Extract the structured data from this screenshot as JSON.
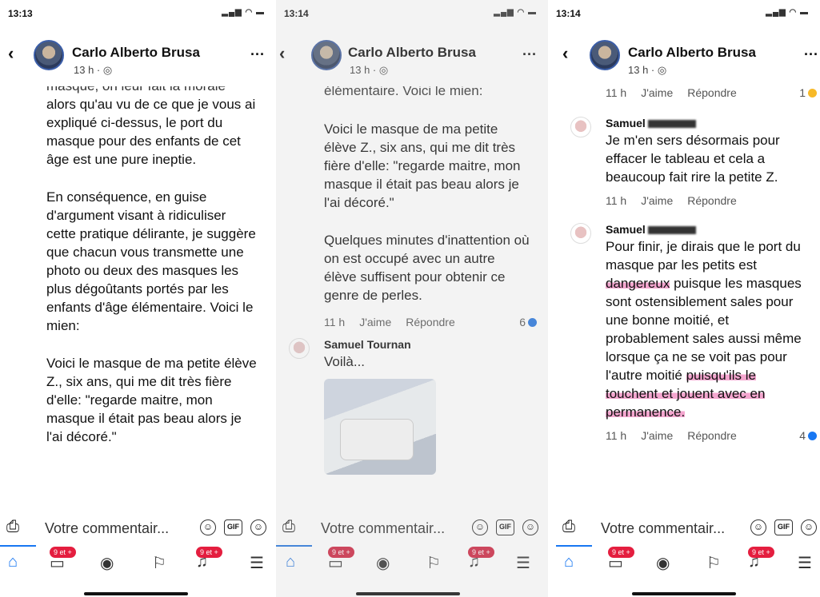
{
  "panels": [
    {
      "status_time": "13:13",
      "author": "Carlo Alberto Brusa",
      "time": "13 h · ",
      "post_partial": "masque, on leur fait la morale",
      "post_paragraphs": [
        "alors qu'au vu de ce que je vous ai expliqué ci-dessus, le port du masque pour des enfants de cet âge est une pure ineptie.",
        "En conséquence, en guise d'argument visant à ridiculiser cette pratique délirante, je suggère que chacun vous transmette une photo ou deux des masques les plus dégoûtants portés par les enfants d'âge élémentaire. Voici le mien:",
        "Voici le masque de ma petite élève Z., six ans, qui me dit très fière d'elle: \"regarde maitre, mon masque il était pas beau alors je l'ai décoré.\""
      ]
    },
    {
      "status_time": "13:14",
      "author": "Carlo Alberto Brusa",
      "time": "13 h · ",
      "post_partial": "élémentaire. Voici le mien:",
      "post_paragraphs": [
        "Voici le masque de ma petite élève Z., six ans, qui me dit très fière d'elle: \"regarde maitre, mon masque il était pas beau alors je l'ai décoré.\"",
        "Quelques minutes d'inattention où on est occupé avec un autre élève suffisent pour obtenir ce genre de perles."
      ],
      "meta": {
        "time": "11 h",
        "like": "J'aime",
        "reply": "Répondre",
        "count": "6"
      },
      "comment": {
        "name": "Samuel Tournan",
        "text": "Voilà..."
      }
    },
    {
      "status_time": "13:14",
      "author": "Carlo Alberto Brusa",
      "time": "13 h · ",
      "top_meta": {
        "time": "11 h",
        "like": "J'aime",
        "reply": "Répondre",
        "count": "1"
      },
      "comment1": {
        "name": "Samuel",
        "text": "Je m'en sers désormais pour effacer le tableau et cela a beaucoup fait rire la petite Z.",
        "meta": {
          "time": "11 h",
          "like": "J'aime",
          "reply": "Répondre"
        }
      },
      "comment2": {
        "name": "Samuel",
        "text_a": "Pour finir, je dirais que le port du masque par les petits est ",
        "text_hl1": "dangereux",
        "text_b": " puisque les masques sont ostensiblement sales pour une bonne moitié, et probablement sales aussi même lorsque ça ne se voit pas pour l'autre moitié ",
        "text_hl2": "puisqu'ils le touchent et jouent avec en permanence.",
        "meta": {
          "time": "11 h",
          "like": "J'aime",
          "reply": "Répondre",
          "count": "4"
        }
      }
    }
  ],
  "comment_placeholder": "Votre commentair...",
  "gif_label": "GIF",
  "badge": "9 et +",
  "icons": [
    "camera-icon",
    "sticker-icon",
    "gif-icon",
    "emoji-icon",
    "home-icon",
    "video-icon",
    "groups-icon",
    "flag-icon",
    "notifications-icon",
    "menu-icon"
  ],
  "colors": {
    "accent": "#1877f2",
    "highlight": "#f4a6cf",
    "badge": "#e41e3f"
  }
}
